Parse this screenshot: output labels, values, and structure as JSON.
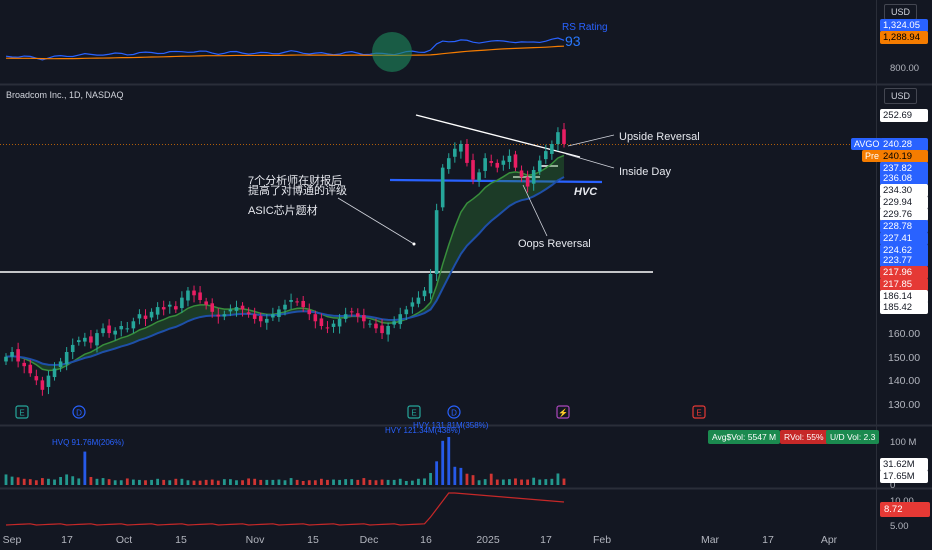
{
  "header": {
    "symbol_title": "Broadcom Inc., 1D, NASDAQ",
    "currency_top": "USD",
    "currency_main": "USD"
  },
  "rs_panel": {
    "label": "RS Rating",
    "rating": "93",
    "price_labels": [
      {
        "text": "1,324.05",
        "bg": "#2962ff",
        "fg": "#ffffff"
      },
      {
        "text": "1,288.94",
        "bg": "#f57c00",
        "fg": "#000000"
      }
    ],
    "scale_label": "800.00"
  },
  "annotations": {
    "analysts_cn_line1": "7个分析师在财报后",
    "analysts_cn_line2": "提高了对博通的评级",
    "asic": "ASIC芯片题材",
    "upside_reversal": "Upside Reversal",
    "inside_day": "Inside Day",
    "hvc": "HVC",
    "oops_reversal": "Oops Reversal"
  },
  "price_axis_labels": [
    {
      "text": "252.69",
      "bg": "#ffffff",
      "fg": "#131722"
    },
    {
      "text": "240.28",
      "bg": "#2962ff",
      "fg": "#ffffff",
      "tag": "AVGO",
      "tag_bg": "#2962ff"
    },
    {
      "text": "240.19",
      "bg": "#f57c00",
      "fg": "#000000",
      "tag": "Pre",
      "tag_bg": "#f57c00"
    },
    {
      "text": "237.82",
      "bg": "#2962ff",
      "fg": "#ffffff"
    },
    {
      "text": "236.08",
      "bg": "#2962ff",
      "fg": "#ffffff"
    },
    {
      "text": "234.30",
      "bg": "#ffffff",
      "fg": "#131722"
    },
    {
      "text": "229.94",
      "bg": "#ffffff",
      "fg": "#131722"
    },
    {
      "text": "229.76",
      "bg": "#ffffff",
      "fg": "#131722"
    },
    {
      "text": "228.78",
      "bg": "#2962ff",
      "fg": "#ffffff"
    },
    {
      "text": "227.41",
      "bg": "#2962ff",
      "fg": "#ffffff"
    },
    {
      "text": "224.62",
      "bg": "#2962ff",
      "fg": "#ffffff"
    },
    {
      "text": "223.77",
      "bg": "#2962ff",
      "fg": "#ffffff"
    },
    {
      "text": "217.96",
      "bg": "#e53935",
      "fg": "#ffffff"
    },
    {
      "text": "217.85",
      "bg": "#e53935",
      "fg": "#ffffff"
    },
    {
      "text": "186.14",
      "bg": "#ffffff",
      "fg": "#131722"
    },
    {
      "text": "185.42",
      "bg": "#ffffff",
      "fg": "#131722"
    }
  ],
  "price_ticks": [
    "160.00",
    "150.00",
    "140.00",
    "130.00"
  ],
  "event_markers": [
    {
      "kind": "E",
      "color": "#26a69a"
    },
    {
      "kind": "D",
      "color": "#2962ff"
    },
    {
      "kind": "E",
      "color": "#26a69a"
    },
    {
      "kind": "D",
      "color": "#2962ff"
    },
    {
      "kind": "⚡",
      "color": "#ab47bc"
    },
    {
      "kind": "E",
      "color": "#e53935"
    }
  ],
  "volume_panel": {
    "hvq_label": "HVQ 91.76M(206%)",
    "hvy_label1": "HVY 131.81M(358%)",
    "hvy_label2": "HVY 121.34M(438%)",
    "stats": [
      {
        "text": "Avg$Vol: 5547 M",
        "bg": "#1b8a4f"
      },
      {
        "text": "RVol: 55%",
        "bg": "#c62828"
      },
      {
        "text": "U/D Vol: 2.3",
        "bg": "#1b8a4f"
      }
    ],
    "scale_top": "100 M",
    "scale_bottom": "0",
    "value_labels": [
      {
        "text": "31.62M",
        "bg": "#ffffff",
        "fg": "#131722"
      },
      {
        "text": "17.65M",
        "bg": "#ffffff",
        "fg": "#131722"
      }
    ]
  },
  "bottom_panel": {
    "tick_top": "10.00",
    "value": "8.72",
    "tick_bottom": "5.00"
  },
  "time_axis": [
    "Sep",
    "17",
    "Oct",
    "15",
    "Nov",
    "15",
    "Dec",
    "16",
    "2025",
    "17",
    "Feb",
    "Mar",
    "17",
    "Apr"
  ],
  "chart_data": {
    "type": "candlestick",
    "title": "Broadcom Inc., 1D, NASDAQ",
    "ylim": [
      125,
      257
    ],
    "last_price": 240.28,
    "support_level": 175,
    "hvc_level": 226,
    "closes": [
      150,
      152,
      148,
      146,
      143,
      140,
      136,
      142,
      145,
      148,
      152,
      155,
      157,
      158,
      156,
      160,
      162,
      160,
      161,
      163,
      162,
      165,
      168,
      166,
      169,
      171,
      170,
      172,
      170,
      175,
      178,
      176,
      174,
      172,
      169,
      167,
      168,
      170,
      171,
      170,
      168,
      166,
      165,
      166,
      168,
      170,
      172,
      174,
      173,
      171,
      168,
      165,
      163,
      162,
      164,
      166,
      168,
      169,
      167,
      165,
      164,
      162,
      160,
      163,
      165,
      168,
      170,
      173,
      175,
      178,
      185,
      212,
      230,
      234,
      238,
      240,
      232,
      225,
      228,
      234,
      232,
      230,
      233,
      235,
      230,
      226,
      222,
      229,
      233,
      237,
      240,
      245,
      240
    ],
    "volume_m": [
      29,
      23,
      21,
      17,
      16,
      13,
      19,
      17,
      15,
      22,
      29,
      24,
      18,
      91.76,
      22,
      17,
      19,
      16,
      13,
      13,
      18,
      15,
      14,
      13,
      14,
      17,
      14,
      13,
      17,
      17,
      13,
      12,
      12,
      14,
      15,
      12,
      16,
      16,
      13,
      13,
      18,
      17,
      14,
      14,
      14,
      15,
      13,
      19,
      14,
      11,
      13,
      13,
      17,
      14,
      15,
      14,
      16,
      16,
      14,
      19,
      14,
      13,
      15,
      14,
      14,
      17,
      11,
      12,
      17,
      18,
      33,
      65,
      121.34,
      131.81,
      50,
      47,
      31,
      27,
      13,
      16,
      31,
      15,
      15,
      16,
      18,
      15,
      15,
      20,
      15,
      16,
      17,
      31.62,
      17.65
    ],
    "rs_rating": 93,
    "lower_panel_last": 8.72
  }
}
